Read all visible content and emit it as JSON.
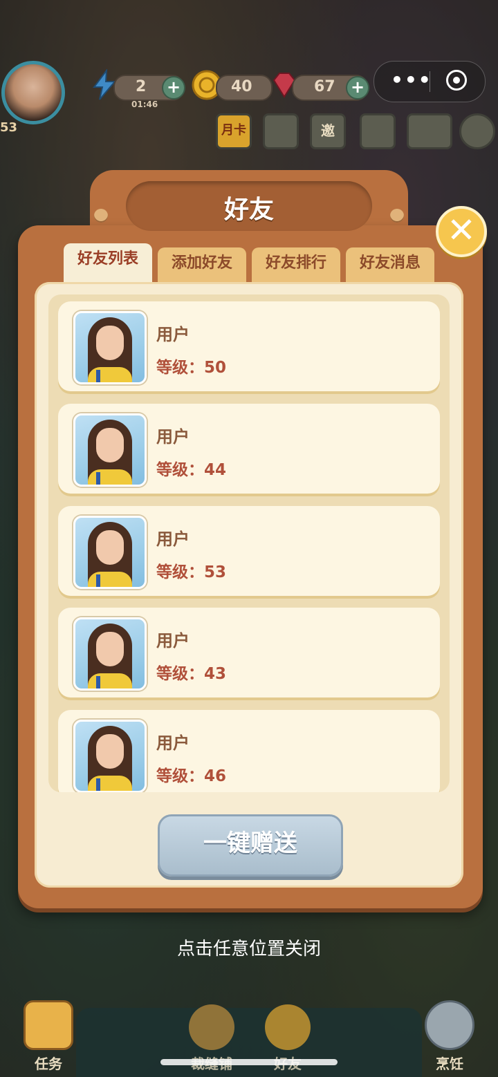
{
  "hud": {
    "player_level": "53",
    "energy": {
      "value": "2",
      "timer": "01:46"
    },
    "coins": "40",
    "gems": "67",
    "plus_label": "+",
    "month_card_label": "月卡",
    "invite_label": "邀"
  },
  "mini_program": {
    "more_label": "•••"
  },
  "panel": {
    "title": "好友",
    "close_label": "✕",
    "tabs": [
      "好友列表",
      "添加好友",
      "好友排行",
      "好友消息"
    ],
    "active_tab": 0,
    "friends": [
      {
        "name": "用户",
        "level_text": "等级：50"
      },
      {
        "name": "用户",
        "level_text": "等级：44"
      },
      {
        "name": "用户",
        "level_text": "等级：53"
      },
      {
        "name": "用户",
        "level_text": "等级：43"
      },
      {
        "name": "用户",
        "level_text": "等级：46"
      }
    ],
    "gift_all_label": "一键赠送"
  },
  "hint": "点击任意位置关闭",
  "bottom_nav": [
    {
      "label": "任务",
      "icon": "task-clipboard-icon"
    },
    {
      "label": "裁缝铺",
      "icon": "sewing-icon"
    },
    {
      "label": "好友",
      "icon": "friends-icon"
    },
    {
      "label": "烹饪",
      "icon": "cooking-pan-icon"
    }
  ],
  "colors": {
    "panel": "#b9703f",
    "inner": "#f7ecd2",
    "tab": "#ebc17b",
    "active_tab": "#f7eed6",
    "close": "#f6c64e",
    "gift_button": "#b9cbd8",
    "level_text": "#b0503a"
  }
}
